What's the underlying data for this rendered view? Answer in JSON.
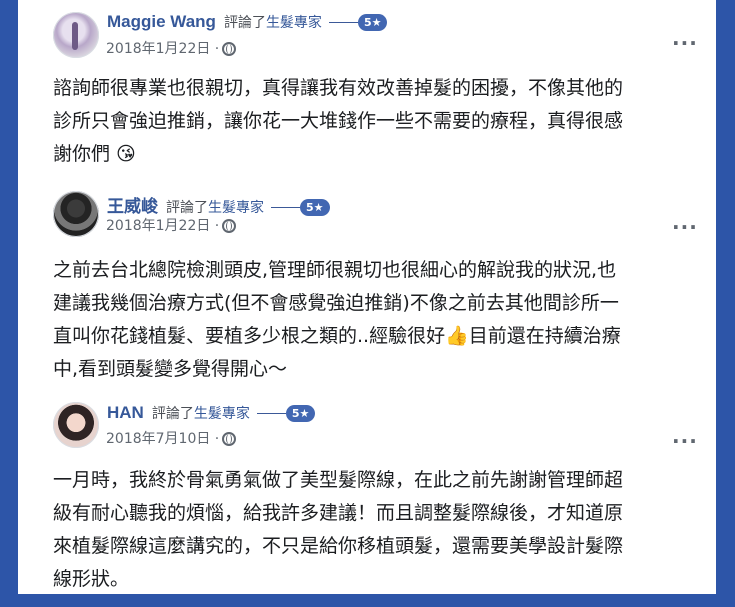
{
  "reviews": [
    {
      "author": "Maggie Wang",
      "reviewed_label": "評論了",
      "page_name": "生髮專家",
      "rating": "5★",
      "date": "2018年1月22日 ·",
      "text_lines": [
        "諮詢師很專業也很親切，真得讓我有效改善掉髮的困擾，不像其他的",
        "診所只會強迫推銷，讓你花一大堆錢作一些不需要的療程，真得很感",
        "謝你們 😘"
      ]
    },
    {
      "author": "王威峻",
      "reviewed_label": "評論了",
      "page_name": "生髮專家",
      "rating": "5★",
      "date": "2018年1月22日 ·",
      "text_lines": [
        "之前去台北總院檢測頭皮,管理師很親切也很細心的解說我的狀況,也",
        "建議我幾個治療方式(但不會感覺強迫推銷)不像之前去其他間診所一",
        "直叫你花錢植髮、要植多少根之類的..經驗很好👍目前還在持續治療",
        "中,看到頭髮變多覺得開心～"
      ]
    },
    {
      "author": "HAN",
      "reviewed_label": "評論了",
      "page_name": "生髮專家",
      "rating": "5★",
      "date": "2018年7月10日 ·",
      "text_lines": [
        "一月時，我終於骨氣勇氣做了美型髮際線，在此之前先謝謝管理師超",
        "級有耐心聽我的煩惱，給我許多建議！而且調整髮際線後，才知道原",
        "來植髮際線這麼講究的，不只是給你移植頭髮，還需要美學設計髮際",
        "線形狀。"
      ]
    }
  ],
  "icons": {
    "privacy": "globe-icon",
    "menu": "more-options-icon"
  },
  "colors": {
    "frame": "#2d55a8",
    "link": "#365899",
    "badge": "#4267b2",
    "text": "#1c1e21",
    "meta": "#606770"
  }
}
